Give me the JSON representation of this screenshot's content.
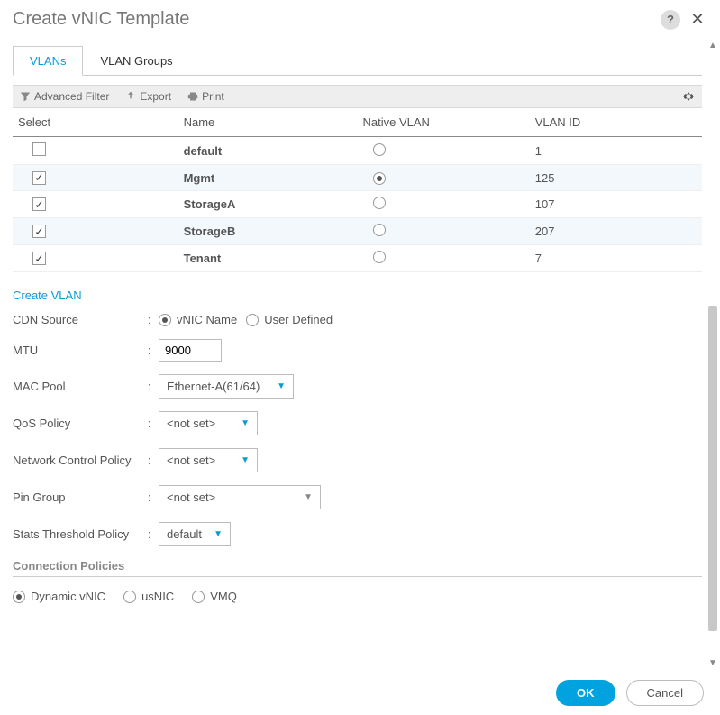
{
  "title": "Create vNIC Template",
  "tabs": {
    "vlans": "VLANs",
    "groups": "VLAN Groups"
  },
  "toolbar": {
    "filter": "Advanced Filter",
    "export": "Export",
    "print": "Print"
  },
  "table": {
    "headers": {
      "select": "Select",
      "name": "Name",
      "native": "Native VLAN",
      "vlanid": "VLAN ID"
    },
    "rows": [
      {
        "selected": false,
        "name": "default",
        "native": false,
        "id": "1"
      },
      {
        "selected": true,
        "name": "Mgmt",
        "native": true,
        "id": "125"
      },
      {
        "selected": true,
        "name": "StorageA",
        "native": false,
        "id": "107"
      },
      {
        "selected": true,
        "name": "StorageB",
        "native": false,
        "id": "207"
      },
      {
        "selected": true,
        "name": "Tenant",
        "native": false,
        "id": "7"
      }
    ]
  },
  "createVlan": "Create VLAN",
  "form": {
    "cdn": {
      "label": "CDN Source",
      "opt1": "vNIC Name",
      "opt2": "User Defined",
      "selected": "vNIC Name"
    },
    "mtu": {
      "label": "MTU",
      "value": "9000"
    },
    "macPool": {
      "label": "MAC Pool",
      "value": "Ethernet-A(61/64)"
    },
    "qos": {
      "label": "QoS Policy",
      "value": "<not set>"
    },
    "netctrl": {
      "label": "Network Control Policy",
      "value": "<not set>"
    },
    "pin": {
      "label": "Pin Group",
      "value": "<not set>"
    },
    "stats": {
      "label": "Stats Threshold Policy",
      "value": "default"
    }
  },
  "conn": {
    "title": "Connection Policies",
    "opt1": "Dynamic vNIC",
    "opt2": "usNIC",
    "opt3": "VMQ",
    "selected": "Dynamic vNIC"
  },
  "buttons": {
    "ok": "OK",
    "cancel": "Cancel"
  }
}
